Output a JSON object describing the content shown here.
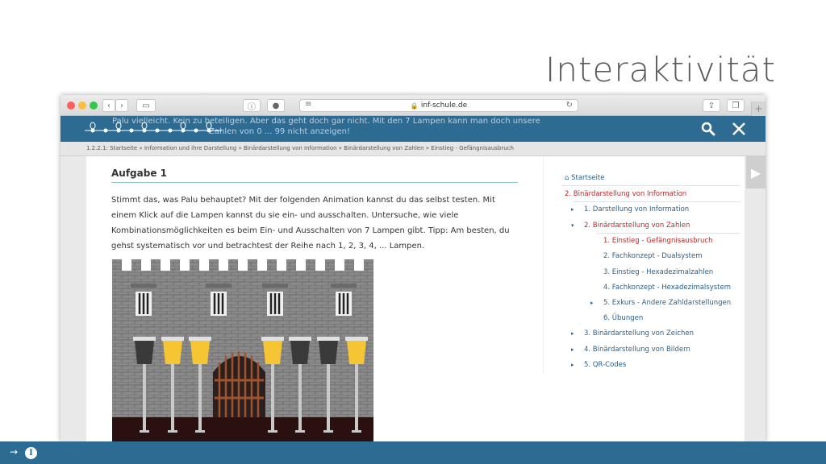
{
  "slide": {
    "title": "Interaktivität"
  },
  "browser": {
    "url": "inf-schule.de",
    "back_icon": "chevron-left",
    "forward_icon": "chevron-right",
    "new_tab_label": "+"
  },
  "header": {
    "ghost_text_line1": "Palu vielleicht. Kein zu beteiligen. Aber das geht doch gar nicht. Mit den 7 Lampen kann man doch unsere",
    "ghost_text_line2": "Zahlen von 0 ... 99 nicht anzeigen!",
    "search_icon": "search-icon",
    "close_icon": "close-icon"
  },
  "breadcrumb": "1.2.2.1: Startseite  » Information und ihre Darstellung  » Binärdarstellung von Information  » Binärdarstellung von Zahlen  » Einstieg - Gefängnisausbruch",
  "task": {
    "title": "Aufgabe 1",
    "text": "Stimmt das, was Palu behauptet? Mit der folgenden Animation kannst du das selbst testen. Mit einem Klick auf die Lampen kannst du sie ein- und ausschalten. Untersuche, wie viele Kombinationsmöglichkeiten es beim Ein- und Ausschalten von 7 Lampen gibt. Tipp: Am besten, du gehst systematisch vor und betrachtest der Reihe nach 1, 2, 3, 4, ... Lampen."
  },
  "lamps": {
    "states": [
      "off",
      "on",
      "on",
      "on",
      "off",
      "off",
      "on"
    ],
    "on_color": "#f6c533",
    "off_color": "#3a3a3a"
  },
  "nav": {
    "home": "Startseite",
    "items": [
      {
        "label": "2.  Binärdarstellung von Information",
        "active": true
      },
      {
        "label": "1.  Darstellung von Information",
        "active": false
      },
      {
        "label": "2.  Binärdarstellung von Zahlen",
        "active": true
      },
      {
        "label": "1.  Einstieg - Gefängnisausbruch",
        "active": true
      },
      {
        "label": "2.  Fachkonzept - Dualsystem",
        "active": false
      },
      {
        "label": "3.  Einstieg - Hexadezimalzahlen",
        "active": false
      },
      {
        "label": "4.  Fachkonzept - Hexadezimalsystem",
        "active": false
      },
      {
        "label": "5.  Exkurs - Andere Zahldarstellungen",
        "active": false
      },
      {
        "label": "6.  Übungen",
        "active": false
      },
      {
        "label": "3.  Binärdarstellung von Zeichen",
        "active": false
      },
      {
        "label": "4.  Binärdarstellung von Bildern",
        "active": false
      },
      {
        "label": "5.  QR-Codes",
        "active": false
      }
    ]
  },
  "footer": {
    "info_letter": "I"
  },
  "colors": {
    "accent": "#2e6b93",
    "active": "#b72c2c"
  }
}
